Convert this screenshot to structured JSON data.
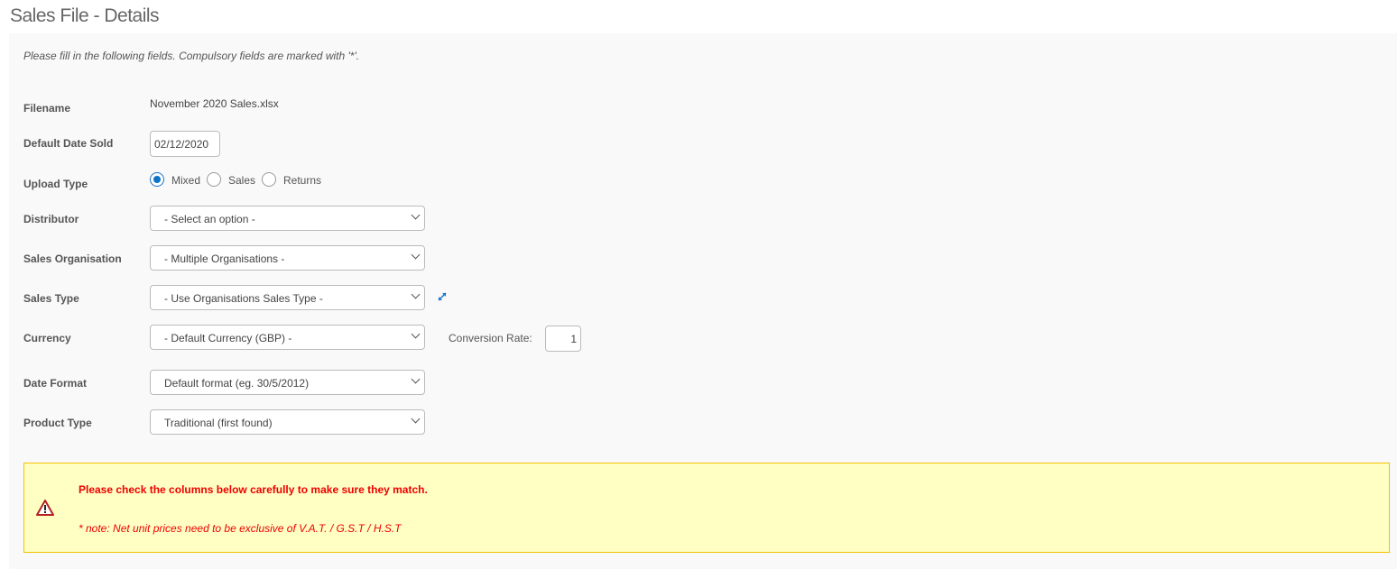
{
  "page_title": "Sales File - Details",
  "intro": "Please fill in the following fields. Compulsory fields are marked with '*'.",
  "fields": {
    "filename": {
      "label": "Filename",
      "value": "November 2020 Sales.xlsx"
    },
    "date_sold": {
      "label": "Default Date Sold",
      "value": "02/12/2020"
    },
    "upload_type": {
      "label": "Upload Type",
      "options": [
        "Mixed",
        "Sales",
        "Returns"
      ],
      "selected": "Mixed"
    },
    "distributor": {
      "label": "Distributor",
      "value": "- Select an option -"
    },
    "sales_org": {
      "label": "Sales Organisation",
      "value": "- Multiple Organisations -"
    },
    "sales_type": {
      "label": "Sales Type",
      "value": "- Use Organisations Sales Type -",
      "expand_icon": "expand-arrows-icon"
    },
    "currency": {
      "label": "Currency",
      "value": "- Default Currency (GBP) -",
      "conversion_label": "Conversion Rate:",
      "conversion_value": "1"
    },
    "date_format": {
      "label": "Date Format",
      "value": "Default format (eg. 30/5/2012)"
    },
    "product_type": {
      "label": "Product Type",
      "value": "Traditional (first found)"
    }
  },
  "warning": {
    "icon": "warning-triangle-icon",
    "title": "Please check the columns below carefully to make sure they match.",
    "note": "* note: Net unit prices need to be exclusive of V.A.T. / G.S.T / H.S.T"
  },
  "colors": {
    "accent": "#0a74c9",
    "warning_bg": "#ffffc4",
    "warning_border": "#f2c200",
    "warning_text": "#ee0000"
  }
}
